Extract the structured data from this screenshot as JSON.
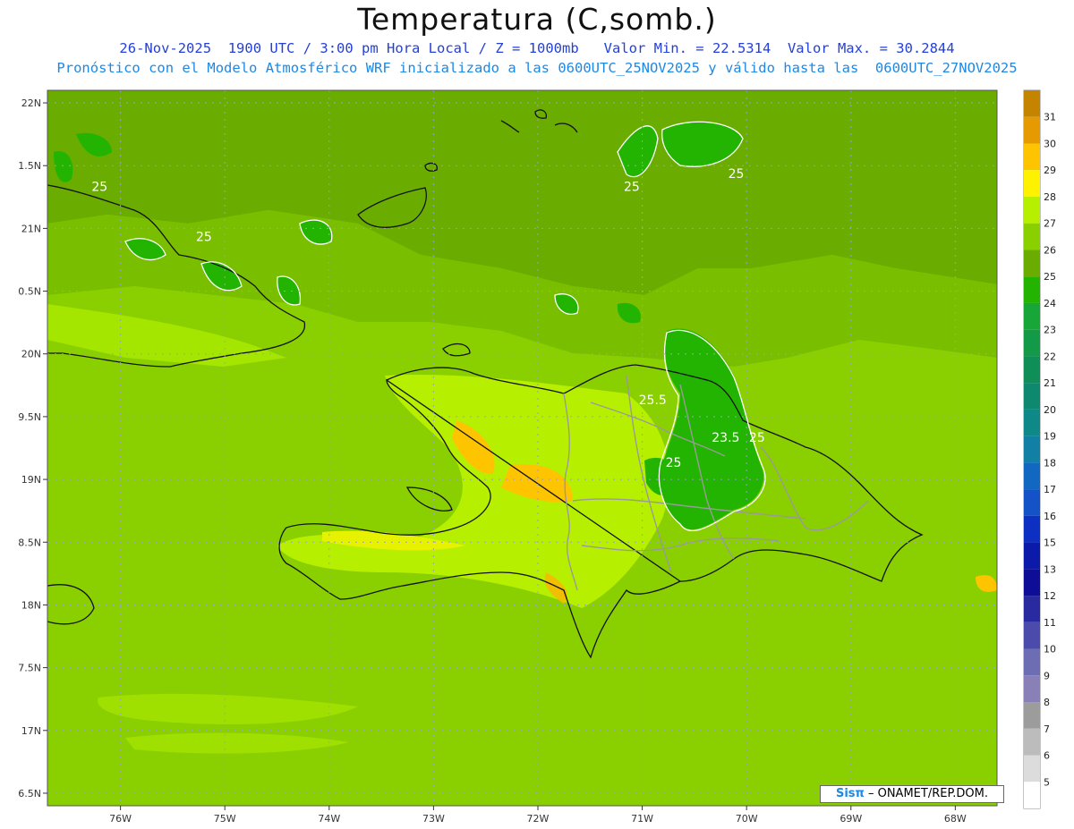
{
  "title": "Temperatura (C,somb.)",
  "subtitle_line1": "26-Nov-2025  1900 UTC / 3:00 pm Hora Local / Z = 1000mb   Valor Min. = 22.5314  Valor Max. = 30.2844",
  "subtitle_line2": "Pronóstico con el Modelo Atmosférico WRF inicializado a las 0600UTC_25NOV2025 y válido hasta las  0600UTC_27NOV2025",
  "credit": {
    "brand": "Sisπ",
    "text": "– ONAMET/REP.DOM."
  },
  "colors": {
    "subtitle1": "#2440d8",
    "subtitle2": "#1e88e5",
    "base_field": "#8ad000",
    "coast": "#111111",
    "province_border": "#9a9a9a",
    "contour": "#ffffff"
  },
  "map_data": {
    "lon_range": [
      -76.7,
      -67.6
    ],
    "lat_range": [
      16.4,
      22.1
    ],
    "lat_ticks": [
      {
        "value": 22,
        "label": "22N"
      },
      {
        "value": 21.5,
        "label": "1.5N"
      },
      {
        "value": 21,
        "label": "21N"
      },
      {
        "value": 20.5,
        "label": "0.5N"
      },
      {
        "value": 20,
        "label": "20N"
      },
      {
        "value": 19.5,
        "label": "9.5N"
      },
      {
        "value": 19,
        "label": "19N"
      },
      {
        "value": 18.5,
        "label": "8.5N"
      },
      {
        "value": 18,
        "label": "18N"
      },
      {
        "value": 17.5,
        "label": "7.5N"
      },
      {
        "value": 17,
        "label": "17N"
      },
      {
        "value": 16.5,
        "label": "6.5N"
      }
    ],
    "lon_ticks": [
      {
        "value": -76,
        "label": "76W"
      },
      {
        "value": -75,
        "label": "75W"
      },
      {
        "value": -74,
        "label": "74W"
      },
      {
        "value": -73,
        "label": "73W"
      },
      {
        "value": -72,
        "label": "72W"
      },
      {
        "value": -71,
        "label": "71W"
      },
      {
        "value": -70,
        "label": "70W"
      },
      {
        "value": -69,
        "label": "69W"
      },
      {
        "value": -68,
        "label": "68W"
      }
    ],
    "contour_labels": [
      {
        "lon": -76.2,
        "lat": 21.3,
        "text": "25"
      },
      {
        "lon": -75.2,
        "lat": 20.9,
        "text": "25"
      },
      {
        "lon": -71.1,
        "lat": 21.3,
        "text": "25"
      },
      {
        "lon": -70.1,
        "lat": 21.4,
        "text": "25"
      },
      {
        "lon": -70.9,
        "lat": 19.6,
        "text": "25.5"
      },
      {
        "lon": -70.2,
        "lat": 19.3,
        "text": "23.5"
      },
      {
        "lon": -69.9,
        "lat": 19.3,
        "text": "25"
      },
      {
        "lon": -70.7,
        "lat": 19.1,
        "text": "25"
      }
    ]
  },
  "legend": {
    "labels": [
      "31",
      "30",
      "29",
      "28",
      "27",
      "26",
      "25",
      "24",
      "23",
      "22",
      "21",
      "20",
      "19",
      "18",
      "17",
      "16",
      "15",
      "13",
      "12",
      "11",
      "10",
      "9",
      "8",
      "7",
      "6",
      "5"
    ],
    "colors": [
      "#c58400",
      "#e49a00",
      "#ffc400",
      "#fff200",
      "#b6f000",
      "#8ad000",
      "#6aad00",
      "#22b400",
      "#18a638",
      "#129a48",
      "#0f8e58",
      "#0f8870",
      "#0f8888",
      "#127fa5",
      "#1268c0",
      "#1452c8",
      "#0e30c2",
      "#0b1aa8",
      "#0d0d98",
      "#2a2aa0",
      "#4b4bac",
      "#6d6db4",
      "#8a80b8",
      "#9c9c9c",
      "#bcbcbc",
      "#dcdcdc",
      "#ffffff"
    ]
  }
}
